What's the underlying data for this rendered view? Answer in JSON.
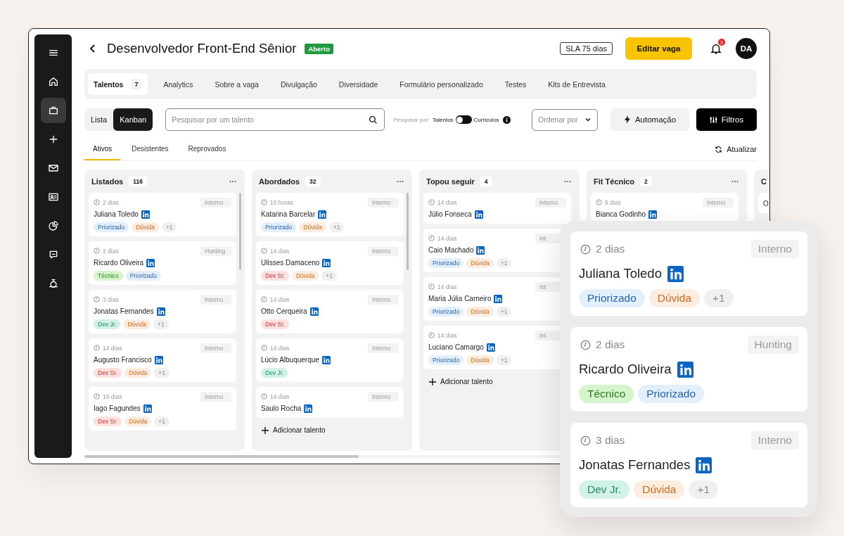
{
  "sidebar": {
    "items": [
      {
        "kind": "menu",
        "selected": false
      },
      {
        "kind": "home",
        "selected": false
      },
      {
        "kind": "briefcase",
        "selected": true
      },
      {
        "kind": "plus",
        "selected": false
      },
      {
        "kind": "mail",
        "selected": false
      },
      {
        "kind": "contact",
        "selected": false
      },
      {
        "kind": "pie",
        "selected": false
      },
      {
        "kind": "chat",
        "selected": false
      },
      {
        "kind": "timer",
        "selected": false
      }
    ]
  },
  "header": {
    "title": "Desenvolvedor Front-End Sênior",
    "status": "Aberto",
    "sla": "SLA 75 dias",
    "edit_button": "Editar vaga",
    "notifications": "3",
    "avatar": "DA"
  },
  "tabs": [
    {
      "label": "Talentos",
      "count": "7",
      "selected": true
    },
    {
      "label": "Analytics",
      "selected": false
    },
    {
      "label": "Sobre a vaga",
      "selected": false
    },
    {
      "label": "Divulgação",
      "selected": false
    },
    {
      "label": "Diversidade",
      "selected": false
    },
    {
      "label": "Formulário personalizado",
      "selected": false
    },
    {
      "label": "Testes",
      "selected": false
    },
    {
      "label": "Kits de Entrevista",
      "selected": false
    }
  ],
  "view_toggle": [
    {
      "label": "Lista",
      "selected": false
    },
    {
      "label": "Kanban",
      "selected": true
    }
  ],
  "search": {
    "placeholder": "Pesquisar por um talento"
  },
  "search_by": {
    "label": "Pesquisar por:",
    "left": "Talentos",
    "right": "Curriculos",
    "on": false
  },
  "sort": {
    "placeholder": "Ordenar por"
  },
  "automation_button": "Automação",
  "filters_button": "Filtros",
  "subtabs": [
    {
      "label": "Ativos",
      "selected": true
    },
    {
      "label": "Desistentes",
      "selected": false
    },
    {
      "label": "Reprovados",
      "selected": false
    }
  ],
  "refresh": "Atualizar",
  "columns": [
    {
      "title": "Listados",
      "count": "116",
      "cards": [
        {
          "time": "2 dias",
          "source": "Interno",
          "name": "Juliana Toledo",
          "tags": [
            {
              "label": "Priorizado",
              "kind": "priority"
            },
            {
              "label": "Dúvida",
              "kind": "doubt"
            },
            {
              "label": "+1",
              "kind": "more"
            }
          ]
        },
        {
          "time": "2 dias",
          "source": "Hunting",
          "name": "Ricardo Oliveira",
          "tags": [
            {
              "label": "Técnico",
              "kind": "technical"
            },
            {
              "label": "Priorizado",
              "kind": "priority"
            }
          ]
        },
        {
          "time": "3 dias",
          "source": "Interno",
          "name": "Jonatas Fernandes",
          "tags": [
            {
              "label": "Dev Jr.",
              "kind": "junior"
            },
            {
              "label": "Dúvida",
              "kind": "doubt"
            },
            {
              "label": "+1",
              "kind": "more"
            }
          ]
        },
        {
          "time": "14 dias",
          "source": "Interno",
          "name": "Augusto Francisco",
          "tags": [
            {
              "label": "Dev Sr.",
              "kind": "senior"
            },
            {
              "label": "Dúvida",
              "kind": "doubt"
            },
            {
              "label": "+1",
              "kind": "more"
            }
          ]
        },
        {
          "time": "16 dias",
          "source": "Interno",
          "name": "Iago Fagundes",
          "tags": [
            {
              "label": "Dev Sr.",
              "kind": "senior"
            },
            {
              "label": "Dúvida",
              "kind": "doubt"
            },
            {
              "label": "+1",
              "kind": "more"
            }
          ]
        }
      ]
    },
    {
      "title": "Abordados",
      "count": "32",
      "add_label": "Adicionar talento",
      "cards": [
        {
          "time": "15 horas",
          "source": "Interno",
          "name": "Katarina Barcelar",
          "tags": [
            {
              "label": "Priorizado",
              "kind": "priority"
            },
            {
              "label": "Dúvida",
              "kind": "doubt"
            },
            {
              "label": "+1",
              "kind": "more"
            }
          ]
        },
        {
          "time": "14 dias",
          "source": "Interno",
          "name": "Ulisses Damaceno",
          "tags": [
            {
              "label": "Dev Sr.",
              "kind": "senior"
            },
            {
              "label": "Dúvida",
              "kind": "doubt"
            },
            {
              "label": "+1",
              "kind": "more"
            }
          ]
        },
        {
          "time": "14 dias",
          "source": "Interno",
          "name": "Otto Cerqueira",
          "tags": [
            {
              "label": "Dev Sr.",
              "kind": "senior"
            }
          ]
        },
        {
          "time": "14 dias",
          "source": "Interno",
          "name": "Lúcio Albuquerque",
          "tags": [
            {
              "label": "Dev Jr.",
              "kind": "junior"
            }
          ]
        },
        {
          "time": "14 dias",
          "source": "Interno",
          "name": "Saulo Rocha"
        }
      ]
    },
    {
      "title": "Topou seguir",
      "count": "4",
      "add_label": "Adicionar talento",
      "cards": [
        {
          "time": "14 dias",
          "source": "Interno",
          "name": "Júlio Fonseca"
        },
        {
          "time": "14 dias",
          "source": "Int",
          "name": "Caio Machado",
          "tags": [
            {
              "label": "Priorizado",
              "kind": "priority"
            },
            {
              "label": "Dúvida",
              "kind": "doubt"
            },
            {
              "label": "+1",
              "kind": "more"
            }
          ]
        },
        {
          "time": "14 dias",
          "source": "Int",
          "name": "Maria Júlia Carneiro",
          "tags": [
            {
              "label": "Priorizado",
              "kind": "priority"
            },
            {
              "label": "Dúvida",
              "kind": "doubt"
            },
            {
              "label": "+1",
              "kind": "more"
            }
          ]
        },
        {
          "time": "14 dias",
          "source": "Int",
          "name": "Luciano Camargo",
          "tags": [
            {
              "label": "Priorizado",
              "kind": "priority"
            },
            {
              "label": "Dúvida",
              "kind": "doubt"
            },
            {
              "label": "+1",
              "kind": "more"
            }
          ]
        }
      ]
    },
    {
      "title": "Fit Técnico",
      "count": "2",
      "cards": [
        {
          "time": "9 dias",
          "source": "Interno",
          "name": "Bianca Godinho"
        }
      ]
    },
    {
      "title": "C",
      "cards": [
        {
          "name": "O"
        }
      ]
    }
  ],
  "overlay": {
    "cards": [
      {
        "time": "2 dias",
        "source": "Interno",
        "name": "Juliana Toledo",
        "tags": [
          {
            "label": "Priorizado",
            "kind": "priority"
          },
          {
            "label": "Dúvida",
            "kind": "doubt"
          },
          {
            "label": "+1",
            "kind": "more"
          }
        ]
      },
      {
        "time": "2 dias",
        "source": "Hunting",
        "name": "Ricardo Oliveira",
        "tags": [
          {
            "label": "Técnico",
            "kind": "technical"
          },
          {
            "label": "Priorizado",
            "kind": "priority"
          }
        ]
      },
      {
        "time": "3 dias",
        "source": "Interno",
        "name": "Jonatas Fernandes",
        "tags": [
          {
            "label": "Dev Jr.",
            "kind": "junior"
          },
          {
            "label": "Dúvida",
            "kind": "doubt"
          },
          {
            "label": "+1",
            "kind": "more"
          }
        ]
      }
    ]
  }
}
